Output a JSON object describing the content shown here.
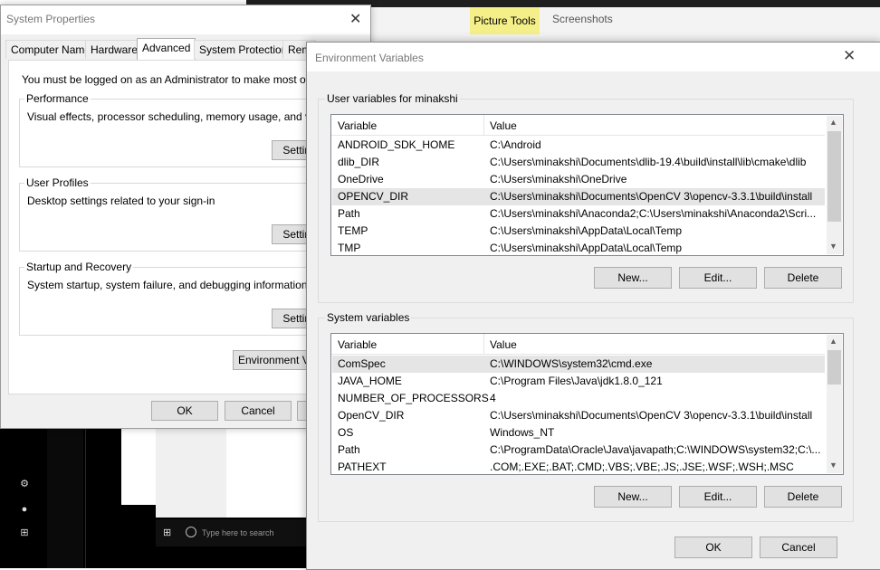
{
  "background": {
    "ribbon_tabs": [
      "Picture Tools",
      "Screenshots"
    ],
    "taskbar_search_placeholder": "Type here to search"
  },
  "system_properties": {
    "title": "System Properties",
    "tabs": [
      "Computer Name",
      "Hardware",
      "Advanced",
      "System Protection",
      "Rem"
    ],
    "selected_tab": "Advanced",
    "admin_note": "You must be logged on as an Administrator to make most of these c",
    "groups": [
      {
        "title": "Performance",
        "desc": "Visual effects, processor scheduling, memory usage, and virtual me",
        "button": "Setting"
      },
      {
        "title": "User Profiles",
        "desc": "Desktop settings related to your sign-in",
        "button": "Setting"
      },
      {
        "title": "Startup and Recovery",
        "desc": "System startup, system failure, and debugging information",
        "button": "Setting"
      }
    ],
    "env_button": "Environment Vari",
    "ok": "OK",
    "cancel": "Cancel"
  },
  "env_vars": {
    "title": "Environment Variables",
    "user_section": {
      "label": "User variables for minakshi",
      "columns": [
        "Variable",
        "Value"
      ],
      "rows": [
        {
          "variable": "ANDROID_SDK_HOME",
          "value": "C:\\Android"
        },
        {
          "variable": "dlib_DIR",
          "value": "C:\\Users\\minakshi\\Documents\\dlib-19.4\\build\\install\\lib\\cmake\\dlib"
        },
        {
          "variable": "OneDrive",
          "value": "C:\\Users\\minakshi\\OneDrive"
        },
        {
          "variable": "OPENCV_DIR",
          "value": "C:\\Users\\minakshi\\Documents\\OpenCV 3\\opencv-3.3.1\\build\\install"
        },
        {
          "variable": "Path",
          "value": "C:\\Users\\minakshi\\Anaconda2;C:\\Users\\minakshi\\Anaconda2\\Scri..."
        },
        {
          "variable": "TEMP",
          "value": "C:\\Users\\minakshi\\AppData\\Local\\Temp"
        },
        {
          "variable": "TMP",
          "value": "C:\\Users\\minakshi\\AppData\\Local\\Temp"
        }
      ],
      "selected_index": 3,
      "buttons": {
        "new": "New...",
        "edit": "Edit...",
        "delete": "Delete"
      }
    },
    "system_section": {
      "label": "System variables",
      "columns": [
        "Variable",
        "Value"
      ],
      "rows": [
        {
          "variable": "ComSpec",
          "value": "C:\\WINDOWS\\system32\\cmd.exe"
        },
        {
          "variable": "JAVA_HOME",
          "value": "C:\\Program Files\\Java\\jdk1.8.0_121"
        },
        {
          "variable": "NUMBER_OF_PROCESSORS",
          "value": "4"
        },
        {
          "variable": "OpenCV_DIR",
          "value": "C:\\Users\\minakshi\\Documents\\OpenCV 3\\opencv-3.3.1\\build\\install"
        },
        {
          "variable": "OS",
          "value": "Windows_NT"
        },
        {
          "variable": "Path",
          "value": "C:\\ProgramData\\Oracle\\Java\\javapath;C:\\WINDOWS\\system32;C:\\..."
        },
        {
          "variable": "PATHEXT",
          "value": ".COM;.EXE;.BAT;.CMD;.VBS;.VBE;.JS;.JSE;.WSF;.WSH;.MSC"
        }
      ],
      "selected_index": 0,
      "buttons": {
        "new": "New...",
        "edit": "Edit...",
        "delete": "Delete"
      }
    },
    "ok": "OK",
    "cancel": "Cancel"
  }
}
